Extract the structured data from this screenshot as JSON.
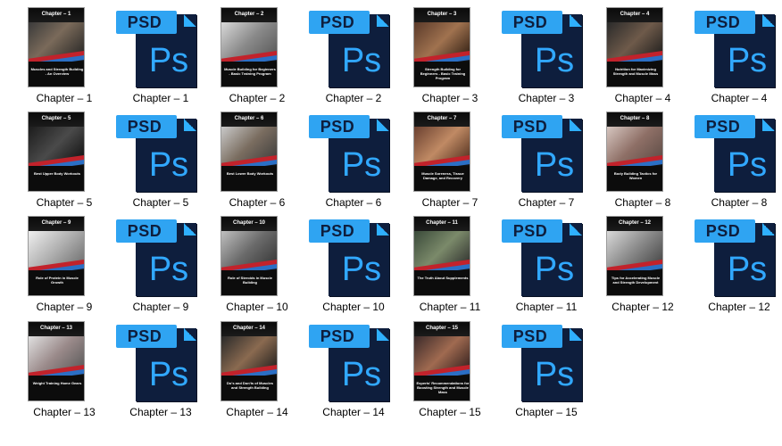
{
  "window": {
    "view": "large-icons"
  },
  "colors": {
    "psd_tab": "#2fa4f2",
    "psd_page": "#0e1e3d",
    "psd_letters": "#31a8ff",
    "cover_red": "#c2222b",
    "cover_blue": "#2b6fc5"
  },
  "files": [
    {
      "type": "cover",
      "label": "Chapter – 1",
      "cover_title": "Chapter – 1",
      "cover_subtitle": "Muscles and Strength Building - An Overview",
      "icon": "image-icon"
    },
    {
      "type": "psd",
      "label": "Chapter – 1",
      "tab_text": "PSD",
      "logo_text": "Ps",
      "icon": "photoshop-file-icon"
    },
    {
      "type": "cover",
      "label": "Chapter – 2",
      "cover_title": "Chapter – 2",
      "cover_subtitle": "Muscle Building for Beginners - Basic Training Program",
      "icon": "image-icon"
    },
    {
      "type": "psd",
      "label": "Chapter – 2",
      "tab_text": "PSD",
      "logo_text": "Ps",
      "icon": "photoshop-file-icon"
    },
    {
      "type": "cover",
      "label": "Chapter – 3",
      "cover_title": "Chapter – 3",
      "cover_subtitle": "Strength Building for Beginners - Basic Training Program",
      "icon": "image-icon"
    },
    {
      "type": "psd",
      "label": "Chapter – 3",
      "tab_text": "PSD",
      "logo_text": "Ps",
      "icon": "photoshop-file-icon"
    },
    {
      "type": "cover",
      "label": "Chapter – 4",
      "cover_title": "Chapter – 4",
      "cover_subtitle": "Nutrition for Maximizing Strength and Muscle Mass",
      "icon": "image-icon"
    },
    {
      "type": "psd",
      "label": "Chapter – 4",
      "tab_text": "PSD",
      "logo_text": "Ps",
      "icon": "photoshop-file-icon"
    },
    {
      "type": "cover",
      "label": "Chapter – 5",
      "cover_title": "Chapter – 5",
      "cover_subtitle": "Best Upper Body Workouts",
      "icon": "image-icon"
    },
    {
      "type": "psd",
      "label": "Chapter – 5",
      "tab_text": "PSD",
      "logo_text": "Ps",
      "icon": "photoshop-file-icon"
    },
    {
      "type": "cover",
      "label": "Chapter – 6",
      "cover_title": "Chapter – 6",
      "cover_subtitle": "Best Lower Body Workouts",
      "icon": "image-icon"
    },
    {
      "type": "psd",
      "label": "Chapter – 6",
      "tab_text": "PSD",
      "logo_text": "Ps",
      "icon": "photoshop-file-icon"
    },
    {
      "type": "cover",
      "label": "Chapter – 7",
      "cover_title": "Chapter – 7",
      "cover_subtitle": "Muscle Soreness, Tissue Damage, and Recovery",
      "icon": "image-icon"
    },
    {
      "type": "psd",
      "label": "Chapter – 7",
      "tab_text": "PSD",
      "logo_text": "Ps",
      "icon": "photoshop-file-icon"
    },
    {
      "type": "cover",
      "label": "Chapter – 8",
      "cover_title": "Chapter – 8",
      "cover_subtitle": "Body Building Tactics for Women",
      "icon": "image-icon"
    },
    {
      "type": "psd",
      "label": "Chapter – 8",
      "tab_text": "PSD",
      "logo_text": "Ps",
      "icon": "photoshop-file-icon"
    },
    {
      "type": "cover",
      "label": "Chapter – 9",
      "cover_title": "Chapter – 9",
      "cover_subtitle": "Role of Protein in Muscle Growth",
      "icon": "image-icon"
    },
    {
      "type": "psd",
      "label": "Chapter – 9",
      "tab_text": "PSD",
      "logo_text": "Ps",
      "icon": "photoshop-file-icon"
    },
    {
      "type": "cover",
      "label": "Chapter – 10",
      "cover_title": "Chapter – 10",
      "cover_subtitle": "Role of Steroids in Muscle Building",
      "icon": "image-icon"
    },
    {
      "type": "psd",
      "label": "Chapter – 10",
      "tab_text": "PSD",
      "logo_text": "Ps",
      "icon": "photoshop-file-icon"
    },
    {
      "type": "cover",
      "label": "Chapter – 11",
      "cover_title": "Chapter – 11",
      "cover_subtitle": "The Truth About Supplements",
      "icon": "image-icon"
    },
    {
      "type": "psd",
      "label": "Chapter – 11",
      "tab_text": "PSD",
      "logo_text": "Ps",
      "icon": "photoshop-file-icon"
    },
    {
      "type": "cover",
      "label": "Chapter – 12",
      "cover_title": "Chapter – 12",
      "cover_subtitle": "Tips for Accelerating Muscle and Strength Development",
      "icon": "image-icon"
    },
    {
      "type": "psd",
      "label": "Chapter – 12",
      "tab_text": "PSD",
      "logo_text": "Ps",
      "icon": "photoshop-file-icon"
    },
    {
      "type": "cover",
      "label": "Chapter – 13",
      "cover_title": "Chapter – 13",
      "cover_subtitle": "Weight Training Home Gears",
      "icon": "image-icon"
    },
    {
      "type": "psd",
      "label": "Chapter – 13",
      "tab_text": "PSD",
      "logo_text": "Ps",
      "icon": "photoshop-file-icon"
    },
    {
      "type": "cover",
      "label": "Chapter – 14",
      "cover_title": "Chapter – 14",
      "cover_subtitle": "Do's and Don'ts of Muscles and Strength Building",
      "icon": "image-icon"
    },
    {
      "type": "psd",
      "label": "Chapter – 14",
      "tab_text": "PSD",
      "logo_text": "Ps",
      "icon": "photoshop-file-icon"
    },
    {
      "type": "cover",
      "label": "Chapter – 15",
      "cover_title": "Chapter – 15",
      "cover_subtitle": "Experts' Recommendations for Boosting Strength and Muscle Mass",
      "icon": "image-icon"
    },
    {
      "type": "psd",
      "label": "Chapter – 15",
      "tab_text": "PSD",
      "logo_text": "Ps",
      "icon": "photoshop-file-icon"
    }
  ]
}
